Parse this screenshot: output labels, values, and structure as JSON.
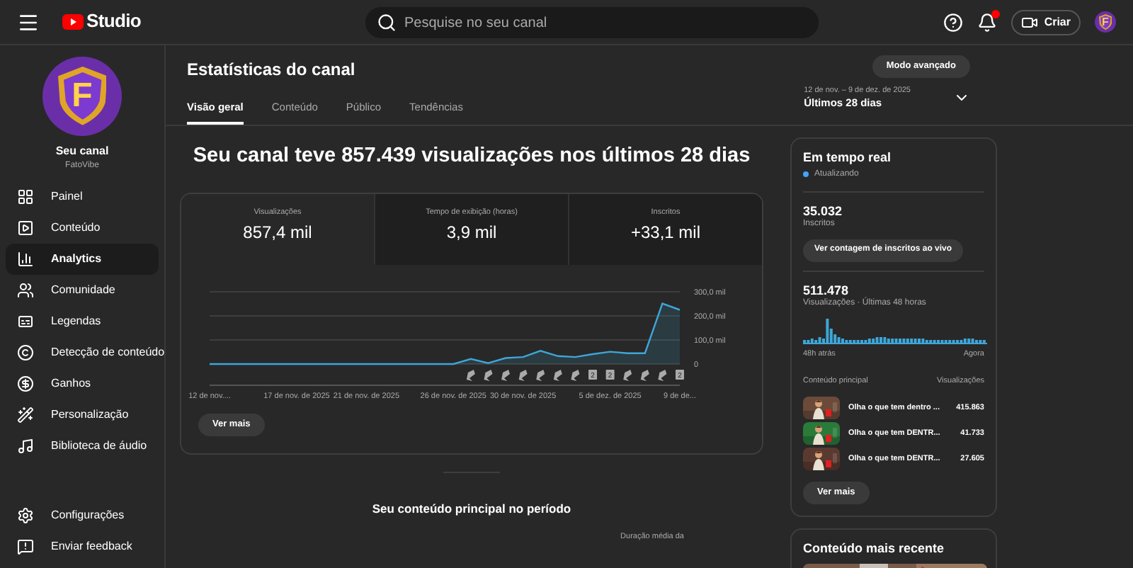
{
  "header": {
    "logo": "Studio",
    "search": {
      "placeholder": "Pesquise no seu canal"
    },
    "create_button": "Criar",
    "notification_dot": true,
    "avatar_letter": "F"
  },
  "sidebar": {
    "channel": {
      "avatar_letter": "F",
      "title": "Seu canal",
      "name": "FatoVibe"
    },
    "items": [
      {
        "label": "Painel",
        "selected": false
      },
      {
        "label": "Conteúdo",
        "selected": false
      },
      {
        "label": "Analytics",
        "selected": true
      },
      {
        "label": "Comunidade",
        "selected": false
      },
      {
        "label": "Legendas",
        "selected": false
      },
      {
        "label": "Detecção de conteúdo",
        "selected": false
      },
      {
        "label": "Ganhos",
        "selected": false
      },
      {
        "label": "Personalização",
        "selected": false
      },
      {
        "label": "Biblioteca de áudio",
        "selected": false
      }
    ],
    "bottom_items": [
      {
        "label": "Configurações"
      },
      {
        "label": "Enviar feedback"
      }
    ]
  },
  "page": {
    "title": "Estatísticas do canal",
    "advanced_button": "Modo avançado",
    "tabs": [
      {
        "label": "Visão geral",
        "selected": true
      },
      {
        "label": "Conteúdo",
        "selected": false
      },
      {
        "label": "Público",
        "selected": false
      },
      {
        "label": "Tendências",
        "selected": false
      }
    ],
    "date_range": {
      "dates": "12 de nov. – 9 de dez. de 2025",
      "label": "Últimos 28 dias"
    }
  },
  "overview": {
    "headline": "Seu canal teve 857.439 visualizações nos últimos 28 dias",
    "metrics": [
      {
        "label": "Visualizações",
        "value": "857,4 mil",
        "selected": true
      },
      {
        "label": "Tempo de exibição (horas)",
        "value": "3,9 mil",
        "selected": false
      },
      {
        "label": "Inscritos",
        "value": "+33,1 mil",
        "selected": false
      }
    ],
    "chart_data": {
      "type": "area",
      "categories": [
        "12 de nov....",
        null,
        null,
        null,
        null,
        "17 de nov. de 2025",
        null,
        null,
        null,
        "21 de nov. de 2025",
        null,
        null,
        null,
        null,
        "26 de nov. de 2025",
        null,
        null,
        null,
        "30 de nov. de 2025",
        null,
        null,
        null,
        null,
        "5 de dez. de 2025",
        null,
        null,
        null,
        "9 de de..."
      ],
      "series": [
        {
          "color": "#3ea6d8",
          "values": [
            0,
            0,
            0,
            0,
            0,
            0,
            0,
            0,
            0,
            0,
            0,
            0,
            0,
            0,
            0,
            21,
            4,
            25,
            29,
            55,
            33,
            29,
            41,
            51,
            45,
            45,
            251,
            225
          ]
        }
      ],
      "ylim": [
        0,
        300
      ],
      "yticks": [
        {
          "value": 0,
          "label": "0"
        },
        {
          "value": 100,
          "label": "100,0 mil"
        },
        {
          "value": 200,
          "label": "200,0 mil"
        },
        {
          "value": 300,
          "label": "300,0 mil"
        }
      ]
    },
    "markers": [
      {
        "kind": "shorts"
      },
      {
        "kind": "shorts"
      },
      {
        "kind": "shorts"
      },
      {
        "kind": "shorts"
      },
      {
        "kind": "shorts"
      },
      {
        "kind": "shorts"
      },
      {
        "kind": "shorts"
      },
      {
        "kind": "count",
        "label": "2"
      },
      {
        "kind": "count",
        "label": "2"
      },
      {
        "kind": "shorts"
      },
      {
        "kind": "shorts"
      },
      {
        "kind": "shorts"
      },
      {
        "kind": "count",
        "label": "2"
      }
    ],
    "more_button": "Ver mais"
  },
  "top_content": {
    "title": "Seu conteúdo principal no período",
    "column": "Duração média da"
  },
  "realtime": {
    "title": "Em tempo real",
    "status": "Atualizando",
    "subscribers": "35.032",
    "subscribers_label": "Inscritos",
    "live_button": "Ver contagem de inscritos ao vivo",
    "views": "511.478",
    "views_label": "Visualizações · Últimas 48 horas",
    "start_label": "48h atrás",
    "end_label": "Agora",
    "columns": [
      "Conteúdo principal",
      "Visualizações"
    ],
    "rows": [
      {
        "title": "Olha o que tem dentro ...",
        "views": "415.863"
      },
      {
        "title": "Olha o que tem DENTR...",
        "views": "41.733"
      },
      {
        "title": "Olha o que tem DENTR...",
        "views": "27.605"
      }
    ],
    "more_button": "Ver mais"
  },
  "latest": {
    "title": "Conteúdo mais recente"
  }
}
